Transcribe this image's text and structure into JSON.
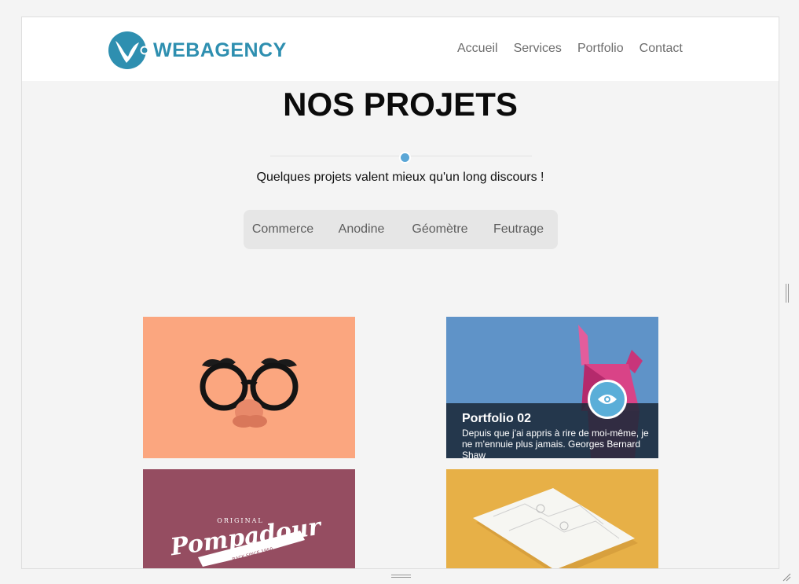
{
  "brand": {
    "name": "WEBAGENCY",
    "color": "#2e8fb0"
  },
  "nav": {
    "items": [
      {
        "label": "Accueil"
      },
      {
        "label": "Services"
      },
      {
        "label": "Portfolio"
      },
      {
        "label": "Contact"
      }
    ]
  },
  "section": {
    "title": "NOS PROJETS",
    "subtitle": "Quelques projets valent mieux qu'un long discours !",
    "accent_color": "#5aa6d6"
  },
  "filters": [
    {
      "label": "Commerce"
    },
    {
      "label": "Anodine"
    },
    {
      "label": "Géomètre"
    },
    {
      "label": "Feutrage"
    }
  ],
  "portfolio": {
    "items": [
      {
        "image": "glasses-nose-illustration",
        "background": "#fba67f"
      },
      {
        "image": "pink-origami-rabbit",
        "background": "#5f93c8",
        "title": "Portfolio 02",
        "description": "Depuis que j'ai appris à rire de moi-même, je ne m'ennuie plus jamais. Georges Bernard Shaw",
        "action_icon": "eye-icon"
      },
      {
        "image": "pompadour-logo",
        "background": "#954d61",
        "logo_text": "Pompadour",
        "logo_top": "ORIGINAL",
        "logo_ribbon": "BACK SINCE 1950"
      },
      {
        "image": "paper-mockup",
        "background": "#e7b047"
      }
    ]
  }
}
